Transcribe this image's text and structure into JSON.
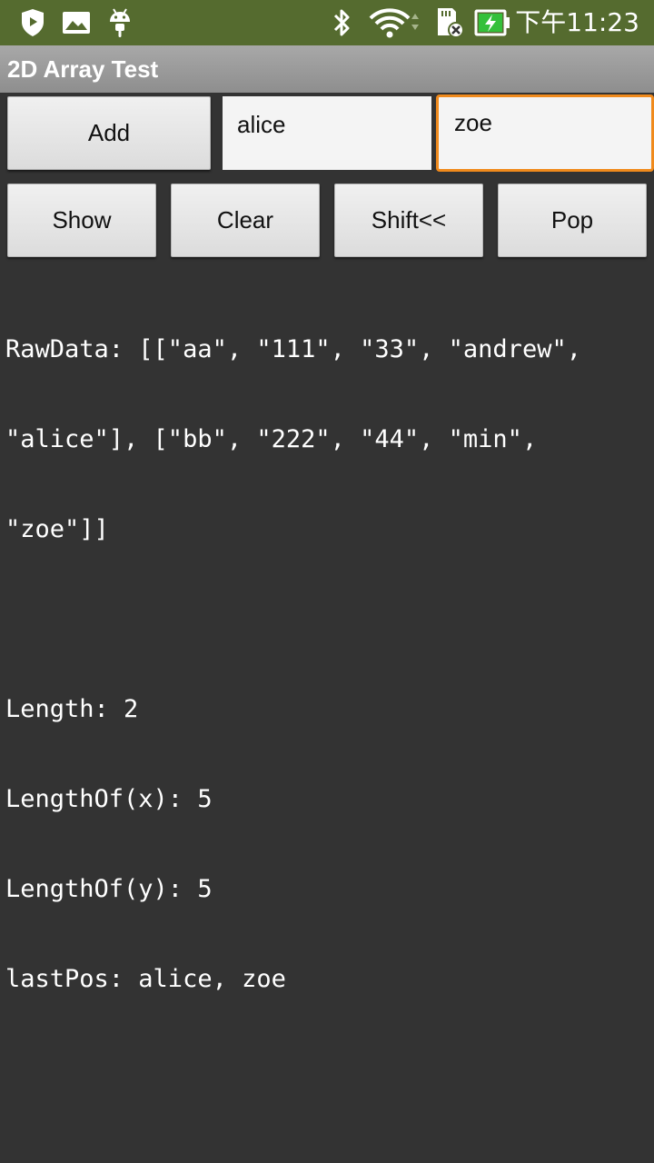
{
  "status_bar": {
    "left_icons": [
      "shield-icon",
      "image-icon",
      "android-icon"
    ],
    "right_icons": [
      "bluetooth-icon",
      "wifi-icon",
      "sd-card-icon",
      "battery-charging-icon"
    ],
    "time": "下午11:23",
    "colors": {
      "background": "#556b2f",
      "battery_accent": "#34c03a"
    }
  },
  "app": {
    "title": "2D Array Test"
  },
  "controls": {
    "add_label": "Add",
    "input_x_value": "alice",
    "input_y_value": "zoe",
    "show_label": "Show",
    "clear_label": "Clear",
    "shift_label": "Shift<<",
    "pop_label": "Pop",
    "focus_color": "#f08a1c"
  },
  "output": {
    "raw_data_line1": "RawData: [[\"aa\", \"111\", \"33\", \"andrew\",",
    "raw_data_line2": "\"alice\"], [\"bb\", \"222\", \"44\", \"min\",",
    "raw_data_line3": "\"zoe\"]]",
    "length": "Length: 2",
    "length_x": "LengthOf(x): 5",
    "length_y": "LengthOf(y): 5",
    "last_pos": "lastPos: alice, zoe"
  }
}
